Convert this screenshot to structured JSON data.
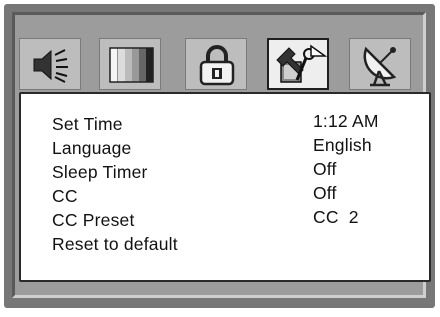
{
  "tabs": [
    {
      "icon": "speaker-icon",
      "label": ""
    },
    {
      "icon": "display-bars-icon",
      "label": ""
    },
    {
      "icon": "padlock-icon",
      "label": ""
    },
    {
      "icon": "tools-setup-icon",
      "label": ""
    },
    {
      "icon": "satellite-dish-icon",
      "label": ""
    }
  ],
  "active_tab": 3,
  "menu": {
    "items": [
      {
        "label": "Set Time",
        "value": "1:12 AM"
      },
      {
        "label": "Language",
        "value": "English"
      },
      {
        "label": "Sleep Timer",
        "value": "Off"
      },
      {
        "label": "CC",
        "value": "Off"
      },
      {
        "label": "CC Preset",
        "value": "CC  2"
      },
      {
        "label": "Reset to default",
        "value": ""
      }
    ]
  },
  "colors": {
    "frame": "#777777",
    "panel": "#ffffff",
    "tab": "#bdbdbd"
  }
}
